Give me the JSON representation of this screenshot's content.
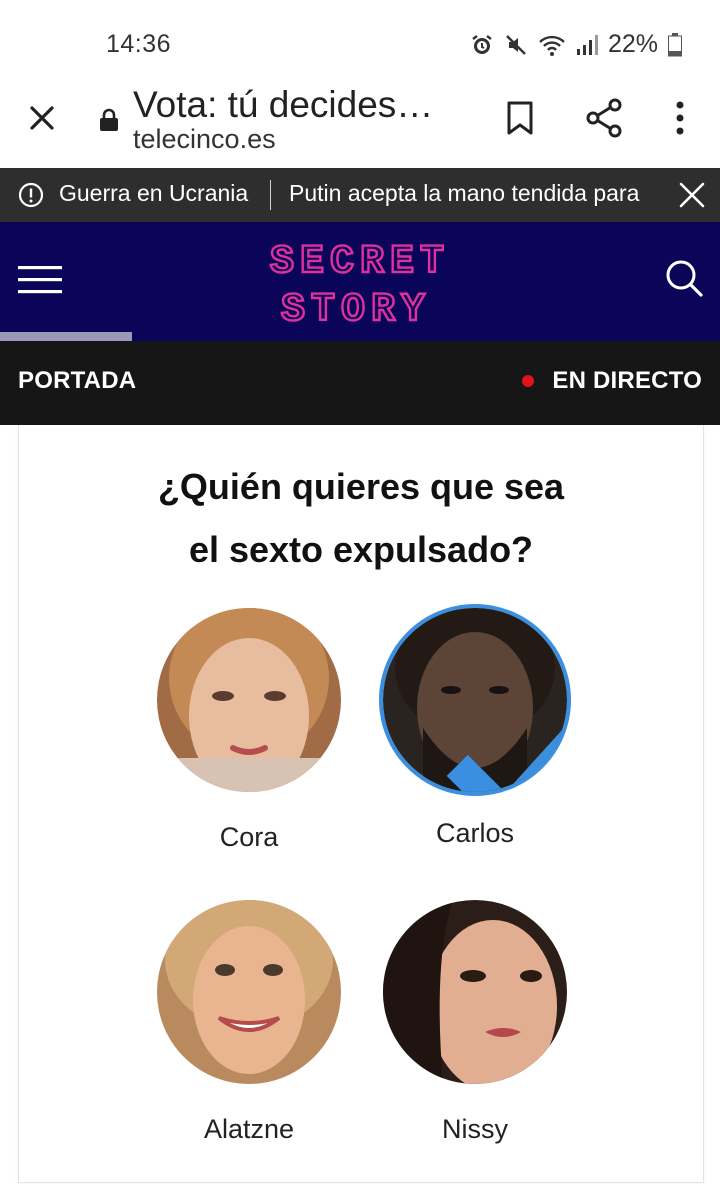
{
  "status_bar": {
    "time": "14:36",
    "battery": "22%",
    "icons": [
      "alarm-icon",
      "mute-icon",
      "wifi-icon",
      "signal-icon",
      "battery-icon"
    ]
  },
  "browser": {
    "page_title": "Vota: tú decides…",
    "domain": "telecinco.es",
    "icons": [
      "close-icon",
      "lock-icon",
      "bookmark-icon",
      "share-icon",
      "more-icon"
    ]
  },
  "ticker": {
    "category": "Guerra en Ucrania",
    "headline": "Putin acepta la mano tendida para"
  },
  "header": {
    "logo_line1": "SECRET",
    "logo_line2": "STORY",
    "brand_color": "#e0309e",
    "background_color": "#0a0558"
  },
  "section_nav": {
    "home_label": "PORTADA",
    "live_label": "EN DIRECTO",
    "live_color": "#e0141e"
  },
  "poll": {
    "question_line1": "¿Quién quieres que sea",
    "question_line2": "el sexto expulsado?",
    "selection_color": "#3a8fe0",
    "candidates": [
      {
        "name": "Cora",
        "selected": false
      },
      {
        "name": "Carlos",
        "selected": true
      },
      {
        "name": "Alatzne",
        "selected": false
      },
      {
        "name": "Nissy",
        "selected": false
      }
    ]
  }
}
